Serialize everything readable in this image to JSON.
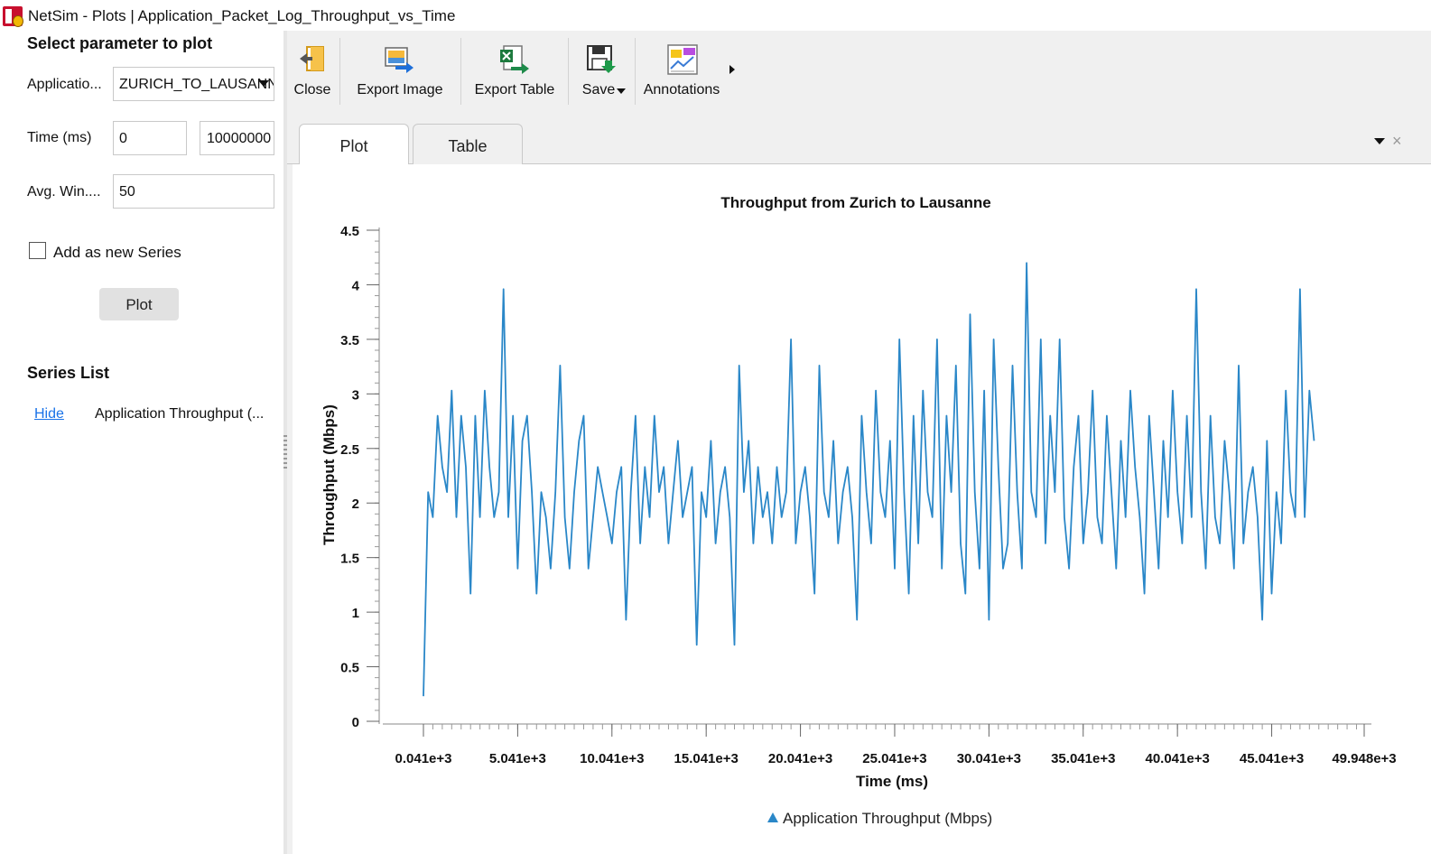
{
  "window": {
    "title": "NetSim - Plots | Application_Packet_Log_Throughput_vs_Time"
  },
  "left_panel": {
    "heading": "Select parameter to plot",
    "application_label": "Applicatio...",
    "application_value": "ZURICH_TO_LAUSANNE",
    "time_label": "Time (ms)",
    "time_start": "0",
    "time_end": "10000000",
    "avg_window_label": "Avg. Win....",
    "avg_window_value": "50",
    "add_series_label": "Add as new Series",
    "add_series_checked": false,
    "plot_button": "Plot",
    "series_list_heading": "Series List",
    "series": [
      {
        "action": "Hide",
        "name": "Application Throughput (..."
      }
    ]
  },
  "toolbar": {
    "close": "Close",
    "export_image": "Export Image",
    "export_table": "Export Table",
    "save": "Save",
    "annotations": "Annotations"
  },
  "tabs": {
    "plot": "Plot",
    "table": "Table",
    "close_glyph": "×"
  },
  "icons": {
    "close": "close-doc-icon",
    "export_image": "export-image-icon",
    "export_table": "export-excel-icon",
    "save": "save-floppy-icon",
    "annotations": "annotations-icon"
  },
  "chart_data": {
    "type": "line",
    "title": "Throughput from Zurich to Lausanne",
    "xlabel": "Time (ms)",
    "ylabel": "Throughput (Mbps)",
    "xlim": [
      41,
      49948
    ],
    "ylim": [
      0,
      4.5
    ],
    "yticks": [
      "0",
      "0.5",
      "1",
      "1.5",
      "2",
      "2.5",
      "3",
      "3.5",
      "4",
      "4.5"
    ],
    "xticks": [
      {
        "x": 41,
        "label": "0.041e+3"
      },
      {
        "x": 5041,
        "label": "5.041e+3"
      },
      {
        "x": 10041,
        "label": "10.041e+3"
      },
      {
        "x": 15041,
        "label": "15.041e+3"
      },
      {
        "x": 20041,
        "label": "20.041e+3"
      },
      {
        "x": 25041,
        "label": "25.041e+3"
      },
      {
        "x": 30041,
        "label": "30.041e+3"
      },
      {
        "x": 35041,
        "label": "35.041e+3"
      },
      {
        "x": 40041,
        "label": "40.041e+3"
      },
      {
        "x": 45041,
        "label": "45.041e+3"
      },
      {
        "x": 49948,
        "label": "49.948e+3"
      }
    ],
    "grid": false,
    "legend": "bottom-center",
    "series": [
      {
        "name": "Application Throughput (Mbps)",
        "color": "#2a87c8",
        "x_start": 41,
        "x_step": 250,
        "values": [
          0.23,
          2.1,
          1.87,
          2.8,
          2.33,
          2.1,
          3.03,
          1.87,
          2.8,
          2.33,
          1.17,
          2.8,
          1.87,
          3.03,
          2.33,
          1.87,
          2.1,
          3.96,
          1.87,
          2.8,
          1.4,
          2.57,
          2.8,
          2.1,
          1.17,
          2.1,
          1.87,
          1.4,
          2.1,
          3.26,
          1.87,
          1.4,
          2.1,
          2.57,
          2.8,
          1.4,
          1.87,
          2.33,
          2.1,
          1.87,
          1.63,
          2.1,
          2.33,
          0.93,
          2.1,
          2.8,
          1.63,
          2.33,
          1.87,
          2.8,
          2.1,
          2.33,
          1.63,
          2.1,
          2.57,
          1.87,
          2.1,
          2.33,
          0.7,
          2.1,
          1.87,
          2.57,
          1.63,
          2.1,
          2.33,
          1.87,
          0.7,
          3.26,
          2.1,
          2.57,
          1.63,
          2.33,
          1.87,
          2.1,
          1.63,
          2.33,
          1.87,
          2.1,
          3.5,
          1.63,
          2.1,
          2.33,
          1.87,
          1.17,
          3.26,
          2.1,
          1.87,
          2.57,
          1.63,
          2.1,
          2.33,
          1.87,
          0.93,
          2.8,
          2.1,
          1.63,
          3.03,
          2.1,
          1.87,
          2.57,
          1.4,
          3.5,
          2.1,
          1.17,
          2.8,
          1.63,
          3.03,
          2.1,
          1.87,
          3.5,
          1.4,
          2.8,
          2.1,
          3.26,
          1.63,
          1.17,
          3.73,
          2.1,
          1.4,
          3.03,
          0.93,
          3.5,
          2.33,
          1.4,
          1.63,
          3.26,
          2.1,
          1.4,
          4.2,
          2.1,
          1.87,
          3.5,
          1.63,
          2.8,
          2.1,
          3.5,
          1.87,
          1.4,
          2.33,
          2.8,
          1.63,
          2.1,
          3.03,
          1.87,
          1.63,
          2.8,
          2.1,
          1.4,
          2.57,
          1.87,
          3.03,
          2.33,
          1.87,
          1.17,
          2.8,
          2.1,
          1.4,
          2.57,
          1.87,
          3.03,
          2.1,
          1.63,
          2.8,
          1.87,
          3.96,
          2.1,
          1.4,
          2.8,
          1.87,
          1.63,
          2.57,
          2.1,
          1.4,
          3.26,
          1.63,
          2.1,
          2.33,
          1.87,
          0.93,
          2.57,
          1.17,
          2.1,
          1.63,
          3.03,
          2.1,
          1.87,
          3.96,
          1.87,
          3.03,
          2.57
        ]
      }
    ]
  }
}
